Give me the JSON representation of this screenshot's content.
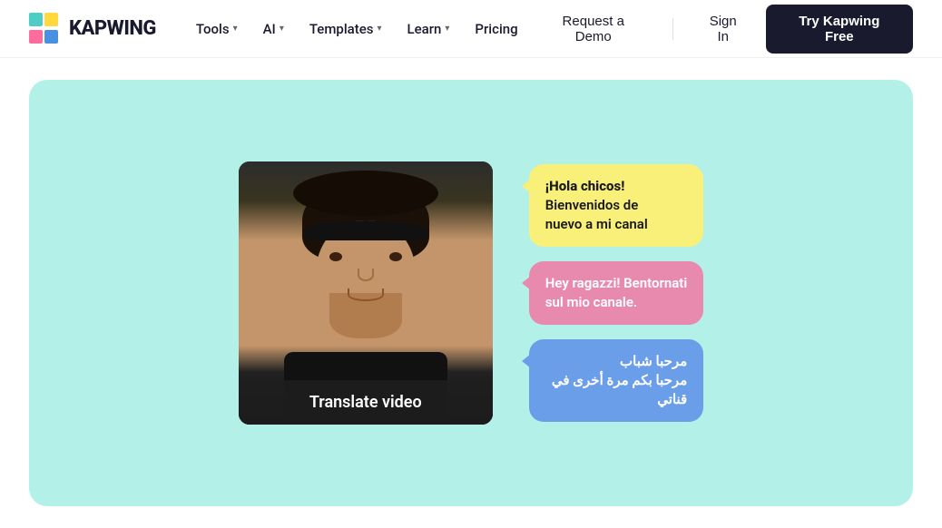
{
  "nav": {
    "logo_text": "KAPWING",
    "items": [
      {
        "label": "Tools",
        "has_dropdown": true
      },
      {
        "label": "AI",
        "has_dropdown": true
      },
      {
        "label": "Templates",
        "has_dropdown": true
      },
      {
        "label": "Learn",
        "has_dropdown": true
      },
      {
        "label": "Pricing",
        "has_dropdown": false
      }
    ],
    "request_demo": "Request a Demo",
    "sign_in": "Sign In",
    "try_free": "Try Kapwing Free"
  },
  "hero": {
    "video_label": "Translate video",
    "bubbles": [
      {
        "id": "bubble1",
        "text_line1": "¡Hola chicos!",
        "text_line2": "Bienvenidos de",
        "text_line3": "nuevo a mi canal",
        "color": "yellow"
      },
      {
        "id": "bubble2",
        "text_line1": "Hey ragazzi! Bentornati",
        "text_line2": "sul mio canale.",
        "color": "pink"
      },
      {
        "id": "bubble3",
        "text_line1": "مرحبا شباب",
        "text_line2": "مرحبا بكم مرة أخرى في",
        "text_line3": "قناتي",
        "color": "blue"
      }
    ]
  }
}
